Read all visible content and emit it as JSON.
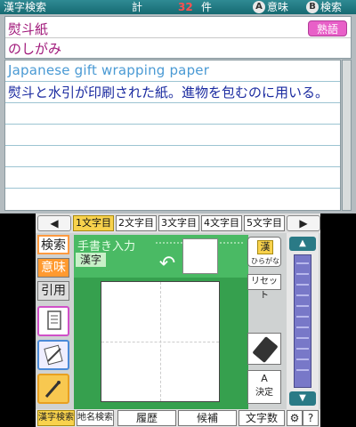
{
  "top": {
    "header": {
      "title": "漢字検索",
      "count_label": "計",
      "count": "32",
      "count_unit": "件",
      "a_button": "A",
      "a_label": "意味",
      "b_button": "B",
      "b_label": "検索"
    },
    "entry": {
      "word": "熨斗紙",
      "reading": "のしがみ",
      "badge": "熟語"
    },
    "definition": {
      "english": "Japanese gift wrapping paper",
      "japanese": "熨斗と水引が印刷された紙。進物を包むのに用いる。"
    }
  },
  "bottom": {
    "tabs": {
      "prev_icon": "◀",
      "next_icon": "▶",
      "items": [
        "1文字目",
        "2文字目",
        "3文字目",
        "4文字目",
        "5文字目"
      ],
      "active_index": 0
    },
    "side": {
      "search": "検索",
      "meaning": "意味",
      "usage": "引用"
    },
    "handwriting": {
      "title": "手書き入力",
      "kanji_tag": "漢字",
      "undo_icon": "↶"
    },
    "right": {
      "conv_chip": "漢",
      "conv_sub": "ひらがな",
      "reset": "リセット",
      "decide_button": "A",
      "decide": "決定"
    },
    "scroll": {
      "up_icon": "▲",
      "down_icon": "▼"
    },
    "bar": {
      "kanji_search": "漢字検索",
      "place_search": "地名検索",
      "history": "履歴",
      "candidates": "候補",
      "char_count": "文字数",
      "settings_icon": "⚙",
      "help_icon": "?"
    }
  },
  "colors": {
    "accent_teal": "#166a72",
    "entry_magenta": "#a0187a",
    "badge_pink": "#e860c8",
    "english_blue": "#4a9ad4",
    "japanese_navy": "#1a2aa0",
    "handwriting_green": "#4aba64",
    "tab_active_yellow": "#f8d24c"
  }
}
